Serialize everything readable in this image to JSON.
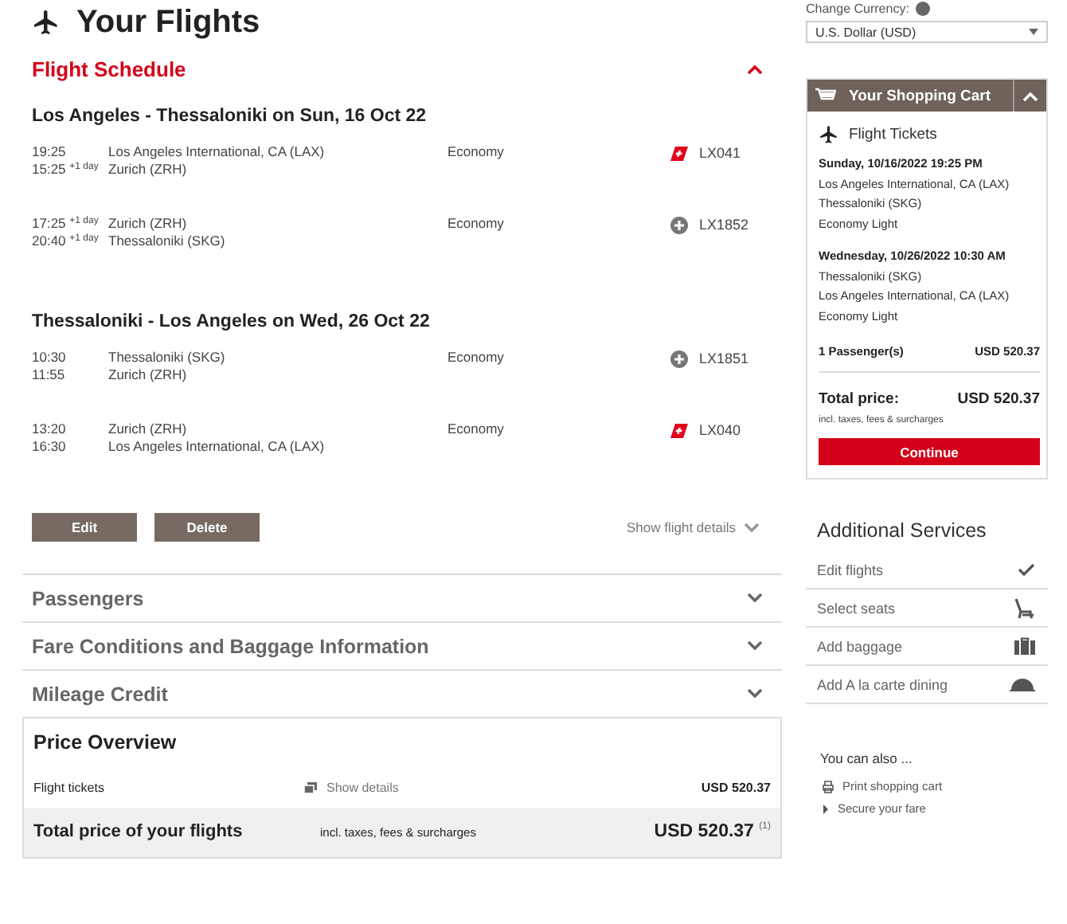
{
  "page": {
    "title": "Your Flights"
  },
  "flight_schedule": {
    "title": "Flight Schedule",
    "expanded": true,
    "legs": [
      {
        "heading": "Los Angeles - Thessaloniki on Sun, 16 Oct 22",
        "segments": [
          {
            "depart": "19:25",
            "arrive": "15:25 $^{+1 day}$",
            "from": "Los Angeles International, CA (LAX)",
            "to": "Zurich (ZRH)",
            "cabin": "Economy",
            "kind": "swiss",
            "flight": "LX041"
          },
          {
            "depart": "17:25 $^{+1 day}$",
            "arrive": "20:40 $^{+1 day}$",
            "from": "Zurich (ZRH)",
            "to": "Thessaloniki (SKG)",
            "cabin": "Economy",
            "kind": "partner",
            "flight": "LX1852"
          }
        ]
      },
      {
        "heading": "Thessaloniki - Los Angeles on Wed, 26 Oct 22",
        "segments": [
          {
            "depart": "10:30",
            "arrive": "11:55",
            "from": "Thessaloniki (SKG)",
            "to": "Zurich (ZRH)",
            "cabin": "Economy",
            "kind": "partner",
            "flight": "LX1851"
          },
          {
            "depart": "13:20",
            "arrive": "16:30",
            "from": "Zurich (ZRH)",
            "to": "Los Angeles International, CA (LAX)",
            "cabin": "Economy",
            "kind": "swiss",
            "flight": "LX040"
          }
        ]
      }
    ],
    "buttons": [
      "Edit",
      "Delete"
    ],
    "details_link": "Show flight details"
  },
  "sections": [
    {
      "title": "Passengers",
      "expanded": false
    },
    {
      "title": "Fare Conditions and Baggage Information",
      "expanded": false
    },
    {
      "title": "Mileage Credit",
      "expanded": false
    }
  ],
  "price_overview": {
    "title": "Price Overview",
    "rows": [
      {
        "label": "Flight tickets",
        "link": "Show details",
        "amount": "USD 520.37"
      }
    ],
    "total": {
      "label": "Total price of your flights",
      "note": "incl. taxes, fees & surcharges",
      "amount": "USD 520.37 $^{(1)}$"
    }
  },
  "currency": {
    "label": "Change Currency:",
    "value": "U.S. Dollar (USD)"
  },
  "cart": {
    "title": "Your Shopping Cart",
    "expanded": true,
    "section": "Flight Tickets",
    "trips": [
      {
        "date": "Sunday, 10/16/2022 19:25 PM",
        "lines": [
          "Los Angeles International, CA (LAX)",
          "Thessaloniki (SKG)",
          "Economy Light"
        ]
      },
      {
        "date": "Wednesday, 10/26/2022 10:30 AM",
        "lines": [
          "Thessaloniki (SKG)",
          "Los Angeles International, CA (LAX)",
          "Economy Light"
        ]
      }
    ],
    "passengers": "1 Passenger(s)",
    "passengers_amount": "USD 520.37",
    "total_label": "Total price:",
    "total_amount": "USD 520.37",
    "total_note": "incl. taxes, fees & surcharges",
    "button": "Continue"
  },
  "additional_services": {
    "title": "Additional Services",
    "items": [
      {
        "label": "Edit flights",
        "kind": "check"
      },
      {
        "label": "Select seats",
        "kind": "seat"
      },
      {
        "label": "Add baggage",
        "kind": "baggage"
      },
      {
        "label": "Add A la carte dining",
        "kind": "dining"
      }
    ]
  },
  "you_can_also": {
    "title": "You can also ...",
    "links": [
      {
        "label": "Print shopping cart",
        "kind": "print"
      },
      {
        "label": "Secure your fare",
        "kind": "arrow"
      }
    ]
  }
}
